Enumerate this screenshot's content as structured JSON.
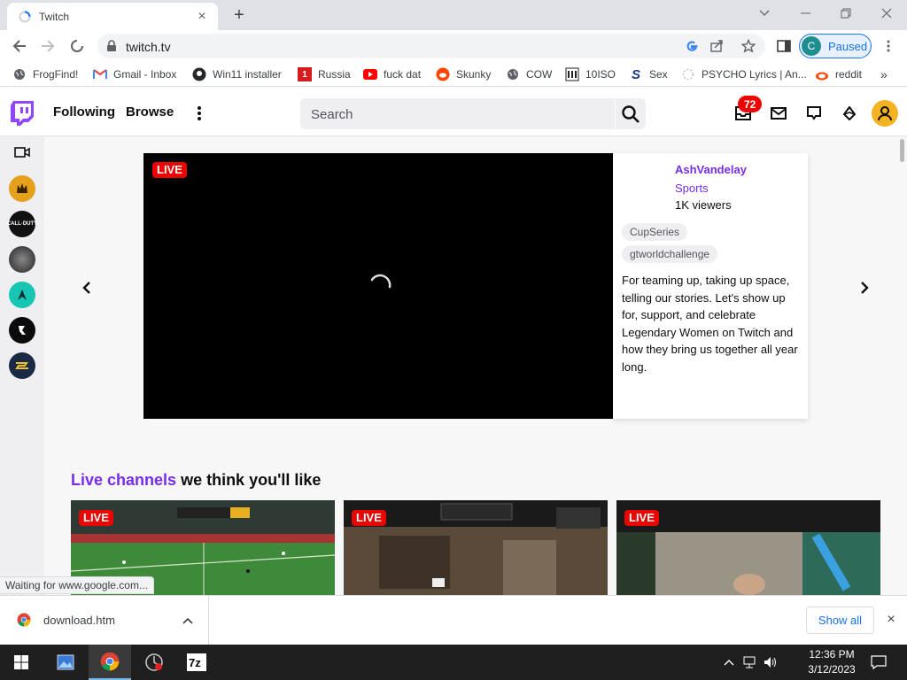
{
  "browser": {
    "tab_title": "Twitch",
    "url": "twitch.tv",
    "profile_initial": "C",
    "profile_status": "Paused",
    "status_text": "Waiting for www.google.com..."
  },
  "bookmarks": [
    {
      "label": "FrogFind!",
      "icon": "globe-icon"
    },
    {
      "label": "Gmail - Inbox",
      "icon": "gmail-icon"
    },
    {
      "label": "Win11 installer",
      "icon": "github-icon"
    },
    {
      "label": "Russia",
      "icon": "news-icon"
    },
    {
      "label": "fuck dat",
      "icon": "youtube-icon"
    },
    {
      "label": "Skunky",
      "icon": "reddit-icon"
    },
    {
      "label": "COW",
      "icon": "globe-icon"
    },
    {
      "label": "10ISO",
      "icon": "building-icon"
    },
    {
      "label": "Sex",
      "icon": "s-logo-icon"
    },
    {
      "label": "PSYCHO Lyrics | An...",
      "icon": "loading-icon"
    },
    {
      "label": "reddit",
      "icon": "reddit-alien-icon"
    }
  ],
  "twitch": {
    "nav": {
      "following": "Following",
      "browse": "Browse"
    },
    "search_placeholder": "Search",
    "notification_count": "72",
    "featured": {
      "live_label": "LIVE",
      "channel": "AshVandelay",
      "category": "Sports",
      "viewers": "1K viewers",
      "tags": [
        "CupSeries",
        "gtworldchallenge"
      ],
      "description": "For teaming up, taking up space, telling our stories. Let's show up for, support, and celebrate Legendary Women on Twitch and how they bring us together all year long."
    },
    "section": {
      "accent": "Live channels",
      "rest": " we think you'll like"
    },
    "cards": [
      {
        "live_label": "LIVE"
      },
      {
        "live_label": "LIVE"
      },
      {
        "live_label": "LIVE"
      }
    ]
  },
  "download": {
    "filename": "download.htm",
    "show_all": "Show all"
  },
  "taskbar": {
    "time": "12:36 PM",
    "date": "3/12/2023"
  }
}
